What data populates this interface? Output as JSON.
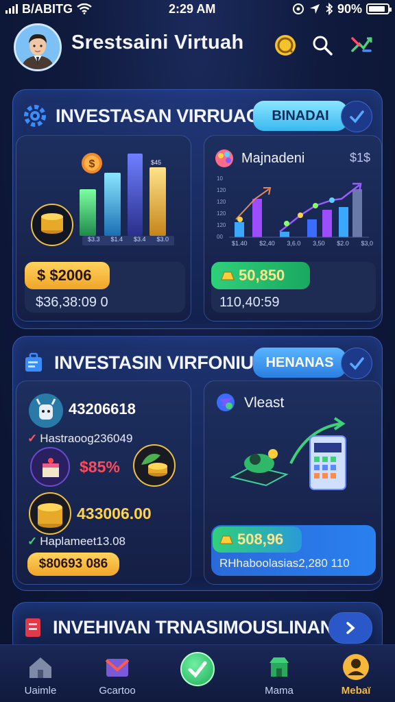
{
  "status_bar": {
    "carrier": "B/ABITG",
    "time": "2:29 AM",
    "battery": "90%",
    "battery_level": 0.9
  },
  "header": {
    "title": "Srestsaini Virtuah"
  },
  "section1": {
    "title": "INVESTASAN VIRRUAGAI",
    "pill": "BINADAI",
    "left_card": {
      "bar_labels": [
        "$3.3",
        "$1.4",
        "$3.4",
        "$3.0"
      ],
      "badge_text": "$45",
      "amount": "$ $2006",
      "sub_amount": "$36,38:09 0"
    },
    "right_card": {
      "title": "Majnadeni",
      "corner": "$1$",
      "y_ticks": [
        "10",
        "120",
        "120",
        "120",
        "120",
        "00"
      ],
      "x_ticks": [
        "$1.40",
        "$2,40",
        "3,6.0",
        "3,50",
        "$2.0",
        "$3,0"
      ],
      "amount": "50,850",
      "sub_amount": "110,40:59"
    }
  },
  "section2": {
    "title": "INVESTASIN VIRFONIUH",
    "pill": "HENANAS",
    "left_card": {
      "top_value": "43206618",
      "check_line": "Hastraoog236049",
      "percent": "$85%",
      "big_value": "433006.00",
      "check_line2": "Haplameet13.08",
      "pill": "$80693 086"
    },
    "right_card": {
      "title": "Vleast",
      "amount": "508,96",
      "sub_amount": "RHhaboolasias2,280 110"
    }
  },
  "section3": {
    "title": "INVEHIVAN TRNASIMOUSLINAN"
  },
  "nav": [
    {
      "label": "Uaimle"
    },
    {
      "label": "Gcartoo"
    },
    {
      "label": ""
    },
    {
      "label": "Mama"
    },
    {
      "label": "Mebaï"
    }
  ],
  "colors": {
    "accent_cyan": "#59d4ff",
    "gold": "#f5b83b",
    "green": "#3fc46a",
    "purple": "#9b4dff"
  }
}
